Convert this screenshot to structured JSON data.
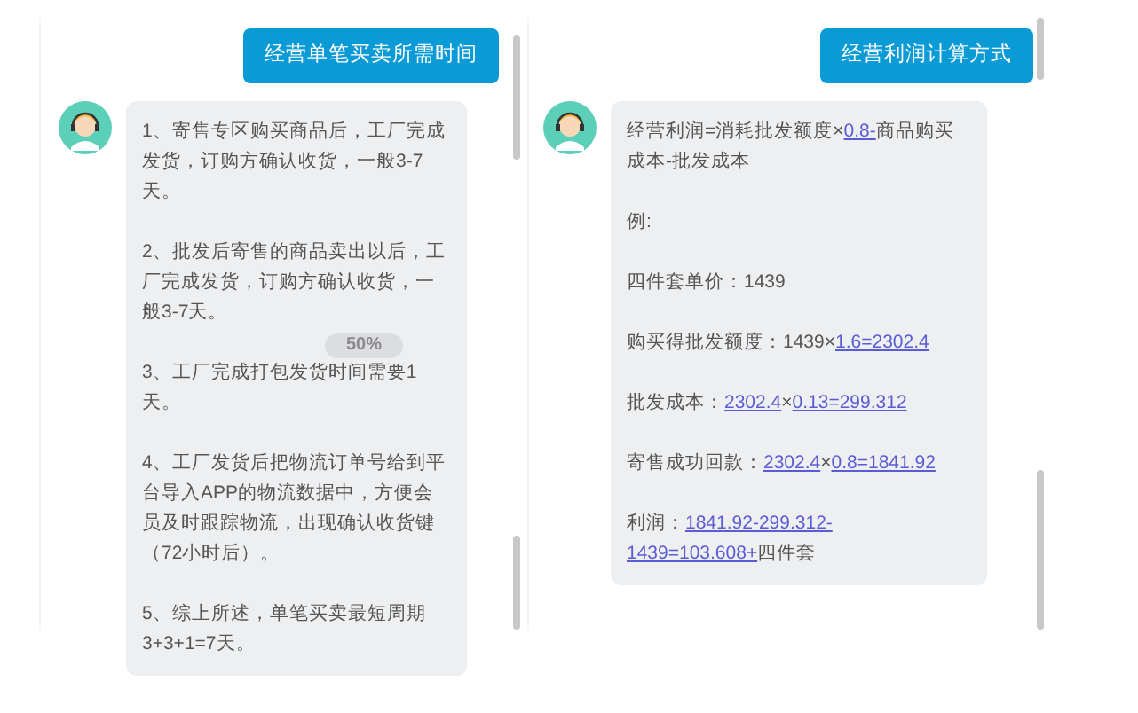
{
  "panels": [
    {
      "question": "经营单笔买卖所需时间",
      "answer": [
        [
          {
            "text": "1、寄售专区购买商品后，工厂完成发货，订购方确认收货，一般3-7天。",
            "link": false
          }
        ],
        [
          {
            "text": "2、批发后寄售的商品卖出以后，工厂完成发货，订购方确认收货，一般3-7天。",
            "link": false
          }
        ],
        [
          {
            "text": "3、工厂完成打包发货时间需要1天。",
            "link": false
          }
        ],
        [
          {
            "text": "4、工厂发货后把物流订单号给到平台导入APP的物流数据中，方便会员及时跟踪物流，出现确认收货键（72小时后）。",
            "link": false
          }
        ],
        [
          {
            "text": "5、综上所述，单笔买卖最短周期3+3+1=7天。",
            "link": false
          }
        ]
      ],
      "overlay": "50%"
    },
    {
      "question": "经营利润计算方式",
      "answer": [
        [
          {
            "text": "经营利润=消耗批发额度×",
            "link": false
          },
          {
            "text": "0.8-",
            "link": true
          },
          {
            "text": "商品购买成本-批发成本",
            "link": false
          }
        ],
        [
          {
            "text": "例:",
            "link": false
          }
        ],
        [
          {
            "text": "四件套单价：1439",
            "link": false
          }
        ],
        [
          {
            "text": "购买得批发额度：1439×",
            "link": false
          },
          {
            "text": "1.6=2302.4",
            "link": true
          }
        ],
        [
          {
            "text": "批发成本：",
            "link": false
          },
          {
            "text": "2302.4",
            "link": true
          },
          {
            "text": "×",
            "link": false
          },
          {
            "text": "0.13=299.312",
            "link": true
          }
        ],
        [
          {
            "text": "寄售成功回款：",
            "link": false
          },
          {
            "text": "2302.4",
            "link": true
          },
          {
            "text": "×",
            "link": false
          },
          {
            "text": "0.8=1841.92",
            "link": true
          }
        ],
        [
          {
            "text": "利润：",
            "link": false
          },
          {
            "text": "1841.92-299.312-1439=103.608+",
            "link": true
          },
          {
            "text": "四件套",
            "link": false
          }
        ]
      ]
    }
  ]
}
